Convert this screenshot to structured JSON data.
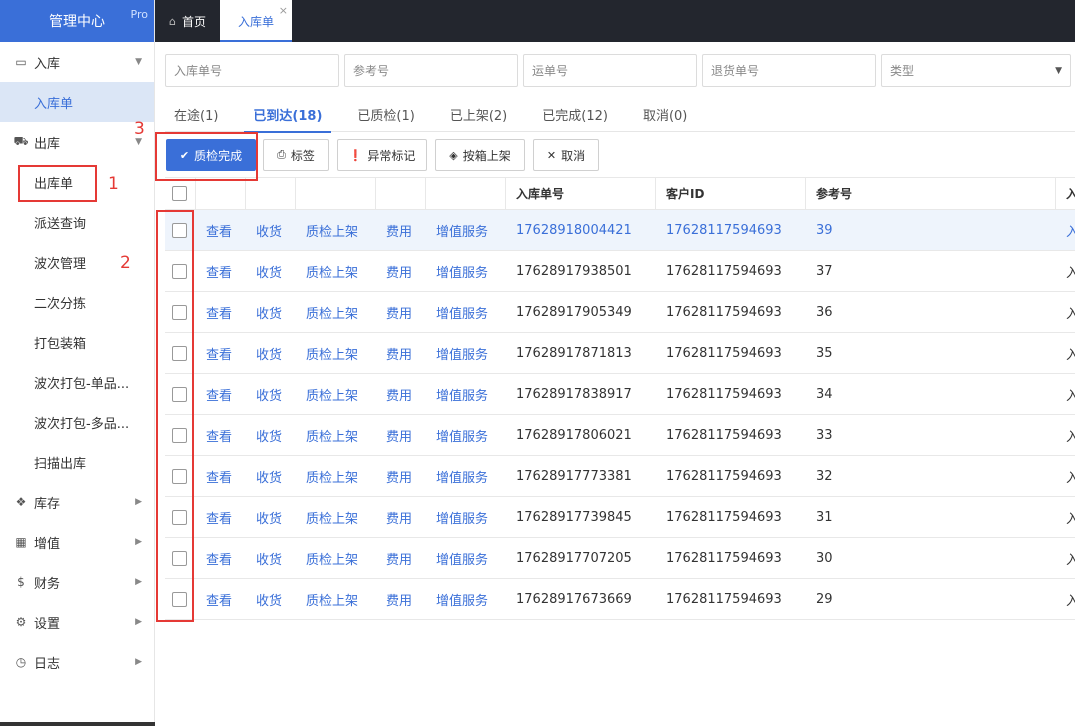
{
  "app": {
    "brand": "管理中心",
    "badge": "Pro"
  },
  "sidebar": {
    "groups": [
      {
        "label": "入库",
        "icon": "inbox-icon",
        "glyph": "▭",
        "expanded": true,
        "items": [
          {
            "label": "入库单",
            "active": true
          }
        ]
      },
      {
        "label": "出库",
        "icon": "truck-icon",
        "glyph": "⛟",
        "expanded": true,
        "items": [
          {
            "label": "出库单"
          },
          {
            "label": "派送查询"
          },
          {
            "label": "波次管理"
          },
          {
            "label": "二次分拣"
          },
          {
            "label": "打包装箱"
          },
          {
            "label": "波次打包-单品..."
          },
          {
            "label": "波次打包-多品..."
          },
          {
            "label": "扫描出库"
          }
        ]
      },
      {
        "label": "库存",
        "icon": "cubes-icon",
        "glyph": "❖",
        "expanded": false
      },
      {
        "label": "增值",
        "icon": "grid-icon",
        "glyph": "▦",
        "expanded": false
      },
      {
        "label": "财务",
        "icon": "dollar-icon",
        "glyph": "$",
        "expanded": false
      },
      {
        "label": "设置",
        "icon": "gears-icon",
        "glyph": "⚙",
        "expanded": false
      },
      {
        "label": "日志",
        "icon": "clock-icon",
        "glyph": "◷",
        "expanded": false
      }
    ]
  },
  "topbar": {
    "tabs": [
      {
        "label": "首页",
        "icon": "home-icon"
      },
      {
        "label": "入库单",
        "active": true,
        "closable": true
      }
    ]
  },
  "filters": [
    {
      "placeholder": "入库单号"
    },
    {
      "placeholder": "参考号"
    },
    {
      "placeholder": "运单号"
    },
    {
      "placeholder": "退货单号"
    },
    {
      "placeholder": "类型",
      "dropdown": true
    }
  ],
  "status_tabs": [
    {
      "label": "在途(1)"
    },
    {
      "label": "已到达(18)",
      "active": true
    },
    {
      "label": "已质检(1)"
    },
    {
      "label": "已上架(2)"
    },
    {
      "label": "已完成(12)"
    },
    {
      "label": "取消(0)"
    }
  ],
  "actions": [
    {
      "label": "质检完成",
      "icon": "check-icon",
      "glyph": "✔",
      "primary": true
    },
    {
      "label": "标签",
      "icon": "print-icon",
      "glyph": "⎙"
    },
    {
      "label": "异常标记",
      "icon": "alert-icon",
      "glyph": "❗"
    },
    {
      "label": "按箱上架",
      "icon": "box-icon",
      "glyph": "◈"
    },
    {
      "label": "取消",
      "icon": "close-icon",
      "glyph": "✕"
    }
  ],
  "annotations": [
    "1",
    "2",
    "3"
  ],
  "table": {
    "headers": [
      "入库单号",
      "客户ID",
      "参考号",
      "入"
    ],
    "row_actions": [
      "查看",
      "收货",
      "质检上架",
      "费用",
      "增值服务"
    ],
    "rows": [
      {
        "order_no": "17628918004421",
        "customer_id": "17628117594693",
        "ref": "39",
        "extra": "入",
        "highlight": true
      },
      {
        "order_no": "17628917938501",
        "customer_id": "17628117594693",
        "ref": "37",
        "extra": "入"
      },
      {
        "order_no": "17628917905349",
        "customer_id": "17628117594693",
        "ref": "36",
        "extra": "入"
      },
      {
        "order_no": "17628917871813",
        "customer_id": "17628117594693",
        "ref": "35",
        "extra": "入"
      },
      {
        "order_no": "17628917838917",
        "customer_id": "17628117594693",
        "ref": "34",
        "extra": "入"
      },
      {
        "order_no": "17628917806021",
        "customer_id": "17628117594693",
        "ref": "33",
        "extra": "入"
      },
      {
        "order_no": "17628917773381",
        "customer_id": "17628117594693",
        "ref": "32",
        "extra": "入"
      },
      {
        "order_no": "17628917739845",
        "customer_id": "17628117594693",
        "ref": "31",
        "extra": "入"
      },
      {
        "order_no": "17628917707205",
        "customer_id": "17628117594693",
        "ref": "30",
        "extra": "入"
      },
      {
        "order_no": "17628917673669",
        "customer_id": "17628117594693",
        "ref": "29",
        "extra": "入"
      }
    ]
  },
  "colors": {
    "accent": "#3a6fd8",
    "topbar": "#23262e",
    "annotation": "#e53935"
  }
}
